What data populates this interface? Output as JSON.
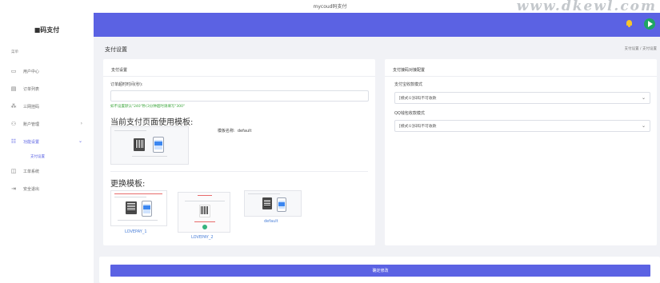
{
  "topbar": {
    "title": "mycoud码支付",
    "watermark": "www.dkewl.com"
  },
  "sidebar": {
    "brand": "■码支付",
    "heading": "菜单",
    "items": [
      {
        "label": "用户中心",
        "icon": "monitor-icon",
        "glyph": "▭"
      },
      {
        "label": "订单列表",
        "icon": "list-icon",
        "glyph": "▤"
      },
      {
        "label": "三网挂码",
        "icon": "grid-icon",
        "glyph": "⁂"
      },
      {
        "label": "账户管理",
        "icon": "users-icon",
        "glyph": "⚇",
        "arrow": "›"
      },
      {
        "label": "功能设置",
        "icon": "settings-icon",
        "glyph": "☷",
        "arrow": "⌄",
        "active": true
      },
      {
        "label": "工单系统",
        "icon": "ticket-icon",
        "glyph": "◫"
      },
      {
        "label": "安全退出",
        "icon": "logout-icon",
        "glyph": "⇥"
      }
    ],
    "submenu_active": "支付设置"
  },
  "header": {
    "accent": "#5b62e3"
  },
  "page": {
    "title": "支付设置",
    "breadcrumb": "支付设置 / 支付设置"
  },
  "left_card": {
    "title": "支付设置",
    "timeout_label": "订单超时时间(秒):",
    "timeout_value": "",
    "timeout_hint": "如不设置默认\"240\"秒(3分钟超时请填写\"300\"",
    "current_template_heading": "当前支付页面使用模板:",
    "template_name_label": "模板名称:",
    "template_name_value": "default",
    "change_template_heading": "更换模板:",
    "templates": [
      "LOVEPAY_1",
      "LOVEPAY_2",
      "default"
    ]
  },
  "right_card": {
    "title": "支付接码对接配置",
    "payment_mode_label": "支付宝收款模式",
    "payment_mode_value": "[模式①]扫码不可收款",
    "qq_mode_label": "QQ钱包收款模式",
    "qq_mode_value": "[模式①]扫码不可收款"
  },
  "confirm_label": "确定修改"
}
